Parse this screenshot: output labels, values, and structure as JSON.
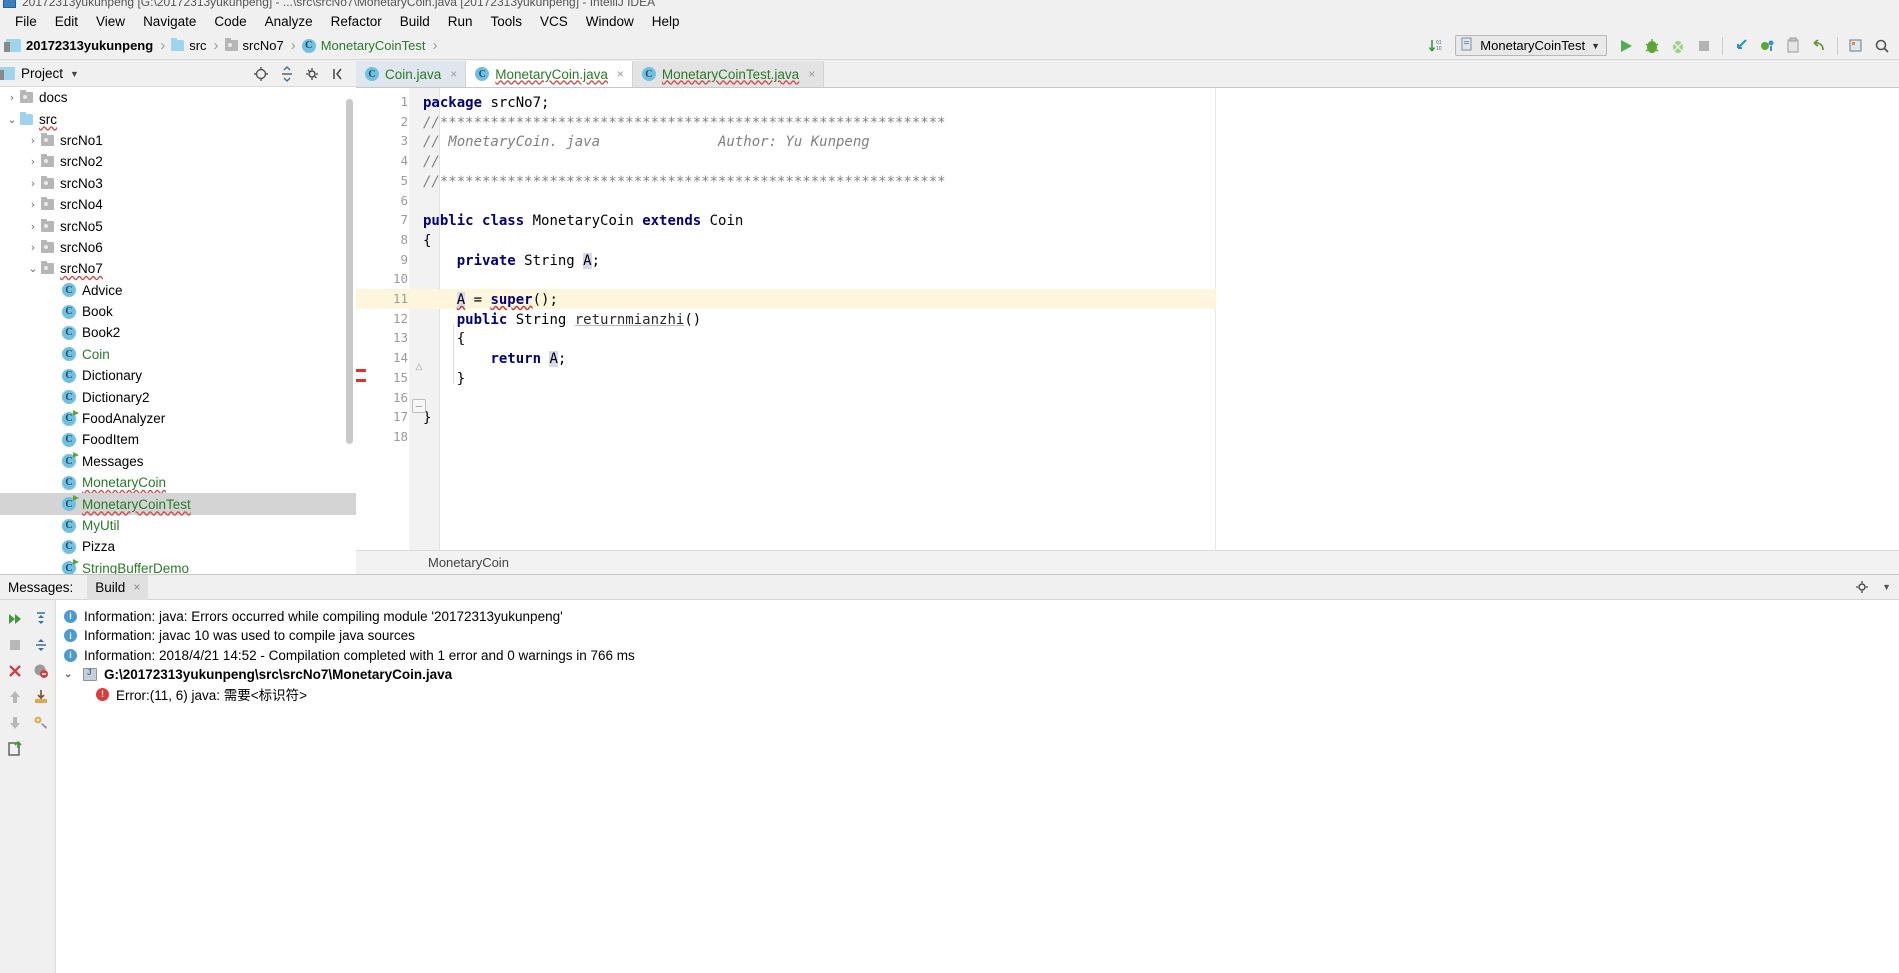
{
  "window": {
    "title": "20172313yukunpeng [G:\\20172313yukunpeng] - ...\\src\\srcNo7\\MonetaryCoin.java [20172313yukunpeng] - IntelliJ IDEA"
  },
  "menubar": {
    "items": [
      "File",
      "Edit",
      "View",
      "Navigate",
      "Code",
      "Analyze",
      "Refactor",
      "Build",
      "Run",
      "Tools",
      "VCS",
      "Window",
      "Help"
    ]
  },
  "breadcrumb": {
    "items": [
      {
        "label": "20172313yukunpeng",
        "icon": "module-icon",
        "style": "bold"
      },
      {
        "label": "src",
        "icon": "folder-blue-icon",
        "style": "normal"
      },
      {
        "label": "srcNo7",
        "icon": "folder-gray-icon",
        "style": "normal"
      },
      {
        "label": "MonetaryCoinTest",
        "icon": "class-icon",
        "style": "green"
      }
    ]
  },
  "toolbar": {
    "run_config": "MonetaryCoinTest",
    "icons": [
      "sort-down-icon",
      "run-icon",
      "debug-icon",
      "run-coverage-icon",
      "stop-icon",
      "attach-icon",
      "profile-icon",
      "clipboard-icon",
      "undo-icon",
      "build-icon",
      "search-icon"
    ]
  },
  "project_panel": {
    "title": "Project",
    "actions": [
      "collapse-target-icon",
      "expand-collapse-icon",
      "settings-gear-icon",
      "hide-icon"
    ],
    "tree": [
      {
        "label": "docs",
        "depth": 1,
        "arrow": "›",
        "icon": "folder-gray",
        "color": "black",
        "wavy": false,
        "selected": false
      },
      {
        "label": "src",
        "depth": 1,
        "arrow": "⌄",
        "icon": "folder-blue",
        "color": "black",
        "wavy": true,
        "selected": false
      },
      {
        "label": "srcNo1",
        "depth": 2,
        "arrow": "›",
        "icon": "folder-gray",
        "color": "black",
        "wavy": false,
        "selected": false
      },
      {
        "label": "srcNo2",
        "depth": 2,
        "arrow": "›",
        "icon": "folder-gray",
        "color": "black",
        "wavy": false,
        "selected": false
      },
      {
        "label": "srcNo3",
        "depth": 2,
        "arrow": "›",
        "icon": "folder-gray",
        "color": "black",
        "wavy": false,
        "selected": false
      },
      {
        "label": "srcNo4",
        "depth": 2,
        "arrow": "›",
        "icon": "folder-gray",
        "color": "black",
        "wavy": false,
        "selected": false
      },
      {
        "label": "srcNo5",
        "depth": 2,
        "arrow": "›",
        "icon": "folder-gray",
        "color": "black",
        "wavy": false,
        "selected": false
      },
      {
        "label": "srcNo6",
        "depth": 2,
        "arrow": "›",
        "icon": "folder-gray",
        "color": "black",
        "wavy": false,
        "selected": false
      },
      {
        "label": "srcNo7",
        "depth": 2,
        "arrow": "⌄",
        "icon": "folder-gray",
        "color": "black",
        "wavy": true,
        "selected": false
      },
      {
        "label": "Advice",
        "depth": 3,
        "arrow": "",
        "icon": "class",
        "color": "black",
        "wavy": false,
        "selected": false
      },
      {
        "label": "Book",
        "depth": 3,
        "arrow": "",
        "icon": "class",
        "color": "black",
        "wavy": false,
        "selected": false
      },
      {
        "label": "Book2",
        "depth": 3,
        "arrow": "",
        "icon": "class",
        "color": "black",
        "wavy": false,
        "selected": false
      },
      {
        "label": "Coin",
        "depth": 3,
        "arrow": "",
        "icon": "class",
        "color": "green",
        "wavy": false,
        "selected": false
      },
      {
        "label": "Dictionary",
        "depth": 3,
        "arrow": "",
        "icon": "class",
        "color": "black",
        "wavy": false,
        "selected": false
      },
      {
        "label": "Dictionary2",
        "depth": 3,
        "arrow": "",
        "icon": "class",
        "color": "black",
        "wavy": false,
        "selected": false
      },
      {
        "label": "FoodAnalyzer",
        "depth": 3,
        "arrow": "",
        "icon": "class-runnable",
        "color": "black",
        "wavy": false,
        "selected": false
      },
      {
        "label": "FoodItem",
        "depth": 3,
        "arrow": "",
        "icon": "class",
        "color": "black",
        "wavy": false,
        "selected": false
      },
      {
        "label": "Messages",
        "depth": 3,
        "arrow": "",
        "icon": "class-runnable",
        "color": "black",
        "wavy": false,
        "selected": false
      },
      {
        "label": "MonetaryCoin",
        "depth": 3,
        "arrow": "",
        "icon": "class",
        "color": "green",
        "wavy": true,
        "selected": false
      },
      {
        "label": "MonetaryCoinTest",
        "depth": 3,
        "arrow": "",
        "icon": "class-runnable",
        "color": "green",
        "wavy": true,
        "selected": true
      },
      {
        "label": "MyUtil",
        "depth": 3,
        "arrow": "",
        "icon": "class",
        "color": "green",
        "wavy": false,
        "selected": false
      },
      {
        "label": "Pizza",
        "depth": 3,
        "arrow": "",
        "icon": "class",
        "color": "black",
        "wavy": false,
        "selected": false
      },
      {
        "label": "StringBufferDemo",
        "depth": 3,
        "arrow": "",
        "icon": "class-runnable",
        "color": "green",
        "wavy": false,
        "selected": false
      }
    ]
  },
  "editor_tabs": [
    {
      "label": "Coin.java",
      "state": "selected",
      "color": "green",
      "close": "×",
      "wavy": false
    },
    {
      "label": "MonetaryCoin.java",
      "state": "active",
      "color": "green",
      "close": "×",
      "wavy": true
    },
    {
      "label": "MonetaryCoinTest.java",
      "state": "inactive",
      "color": "green",
      "close": "×",
      "wavy": true
    }
  ],
  "editor": {
    "line_numbers": [
      "1",
      "2",
      "3",
      "4",
      "5",
      "6",
      "7",
      "8",
      "9",
      "10",
      "11",
      "12",
      "13",
      "14",
      "15",
      "16",
      "17",
      "18"
    ],
    "highlighted_line": 11,
    "breadcrumb": "MonetaryCoin",
    "code_lines": [
      {
        "n": 1,
        "text": "package srcNo7;"
      },
      {
        "n": 2,
        "text": "//************************************************************"
      },
      {
        "n": 3,
        "text": "// MonetaryCoin. java              Author: Yu Kunpeng"
      },
      {
        "n": 4,
        "text": "//"
      },
      {
        "n": 5,
        "text": "//************************************************************"
      },
      {
        "n": 6,
        "text": ""
      },
      {
        "n": 7,
        "text": "public class MonetaryCoin extends Coin"
      },
      {
        "n": 8,
        "text": "{"
      },
      {
        "n": 9,
        "text": "    private String A;"
      },
      {
        "n": 10,
        "text": ""
      },
      {
        "n": 11,
        "text": "    A = super();"
      },
      {
        "n": 12,
        "text": "    public String returnmianzhi()"
      },
      {
        "n": 13,
        "text": "    {"
      },
      {
        "n": 14,
        "text": "        return A;"
      },
      {
        "n": 15,
        "text": "    }"
      },
      {
        "n": 16,
        "text": ""
      },
      {
        "n": 17,
        "text": "}"
      },
      {
        "n": 18,
        "text": ""
      }
    ]
  },
  "messages_panel": {
    "label": "Messages:",
    "tab": "Build",
    "tab_close": "×",
    "settings_icon": "gear-icon",
    "side_icons": [
      "run-all-icon",
      "stop-icon",
      "close-icon",
      "up-icon",
      "down-icon",
      "export-icon",
      "expand-all-icon",
      "collapse-all-icon",
      "hide-warnings-icon",
      "import-icon",
      "settings-icon"
    ],
    "rows": [
      {
        "kind": "info",
        "text": "Information: java: Errors occurred while compiling module '20172313yukunpeng'",
        "indent": 0,
        "bold": false,
        "caret": ""
      },
      {
        "kind": "info",
        "text": "Information: javac 10 was used to compile java sources",
        "indent": 0,
        "bold": false,
        "caret": ""
      },
      {
        "kind": "info",
        "text": "Information: 2018/4/21 14:52 - Compilation completed with 1 error and 0 warnings in 766 ms",
        "indent": 0,
        "bold": false,
        "caret": ""
      },
      {
        "kind": "file",
        "text": "G:\\20172313yukunpeng\\src\\srcNo7\\MonetaryCoin.java",
        "indent": 0,
        "bold": true,
        "caret": "⌄"
      },
      {
        "kind": "error",
        "text": "Error:(11, 6)  java: 需要<标识符>",
        "indent": 1,
        "bold": false,
        "caret": ""
      }
    ]
  },
  "colors": {
    "accent_green": "#2a7a2a",
    "keyword_blue": "#000080",
    "comment_gray": "#808080",
    "error_red": "#e03b3b",
    "highlight_row": "#fdf6dd",
    "selection_gray": "#d4d4d4"
  }
}
